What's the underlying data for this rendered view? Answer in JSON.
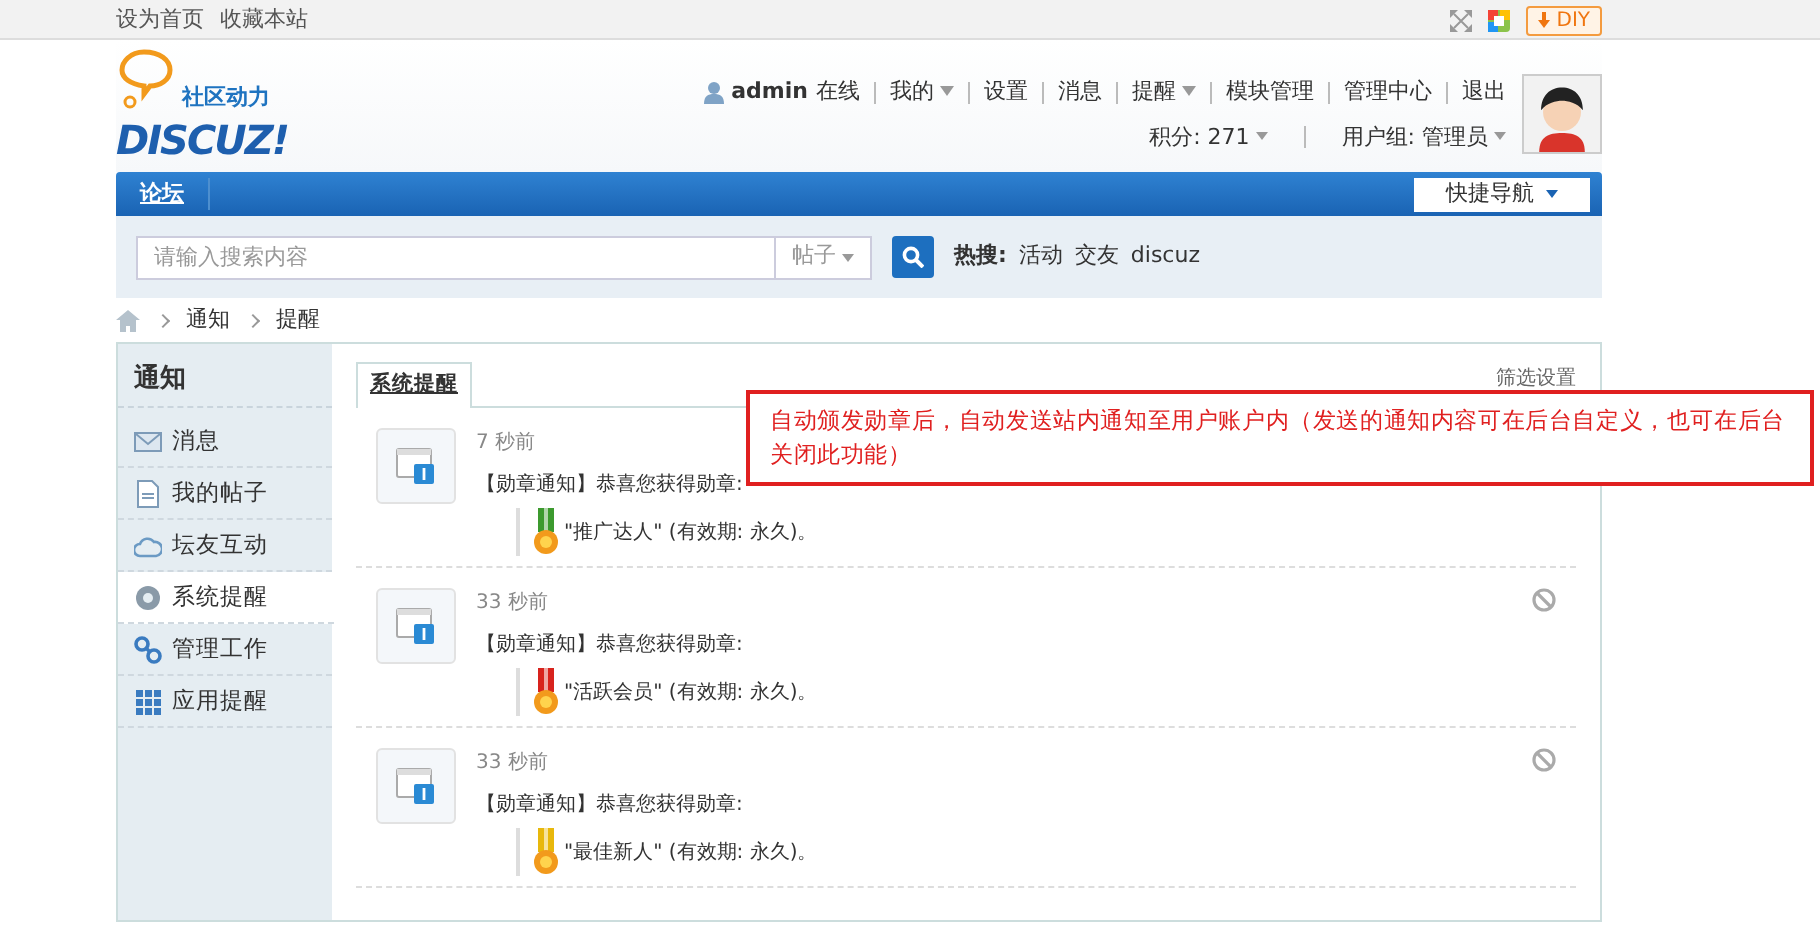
{
  "topbar": {
    "links": [
      "设为首页",
      "收藏本站"
    ],
    "diy_button": "DIY"
  },
  "header": {
    "logo_tagline": "社区动力",
    "logo_word": "DISCUZ!",
    "user": "admin",
    "status": "在线",
    "links": [
      {
        "label": "我的",
        "dropdown": true
      },
      {
        "label": "设置",
        "dropdown": false
      },
      {
        "label": "消息",
        "dropdown": false
      },
      {
        "label": "提醒",
        "dropdown": true
      },
      {
        "label": "模块管理",
        "dropdown": false
      },
      {
        "label": "管理中心",
        "dropdown": false
      },
      {
        "label": "退出",
        "dropdown": false
      }
    ],
    "points_label": "积分:",
    "points": "271",
    "group_label": "用户组:",
    "group": "管理员"
  },
  "nav": {
    "items": [
      "论坛"
    ],
    "quick_nav": "快捷导航"
  },
  "search": {
    "placeholder": "请输入搜索内容",
    "type": "帖子",
    "hot_label": "热搜:",
    "hot": [
      "活动",
      "交友",
      "discuz"
    ]
  },
  "breadcrumb": [
    "通知",
    "提醒"
  ],
  "sidebar": {
    "title": "通知",
    "items": [
      {
        "label": "消息",
        "selected": false
      },
      {
        "label": "我的帖子",
        "selected": false
      },
      {
        "label": "坛友互动",
        "selected": false
      },
      {
        "label": "系统提醒",
        "selected": true
      },
      {
        "label": "管理工作",
        "selected": false
      },
      {
        "label": "应用提醒",
        "selected": false
      }
    ]
  },
  "tabs": [
    {
      "label": "系统提醒",
      "selected": true
    }
  ],
  "filter_link": "筛选设置",
  "notices": [
    {
      "time": "7 秒前",
      "text": "【勋章通知】恭喜您获得勋章:",
      "medal": "\"推广达人\" (有效期: 永久)。",
      "color": "#3c9a2e",
      "delete_visible": false
    },
    {
      "time": "33 秒前",
      "text": "【勋章通知】恭喜您获得勋章:",
      "medal": "\"活跃会员\" (有效期: 永久)。",
      "color": "#d8231d",
      "delete_visible": true
    },
    {
      "time": "33 秒前",
      "text": "【勋章通知】恭喜您获得勋章:",
      "medal": "\"最佳新人\" (有效期: 永久)。",
      "color": "#e8b80c",
      "delete_visible": true
    }
  ],
  "annotation": "自动颁发勋章后，自动发送站内通知至用户账户内（发送的通知内容可在后台自定义，也可在后台关闭此功能）"
}
